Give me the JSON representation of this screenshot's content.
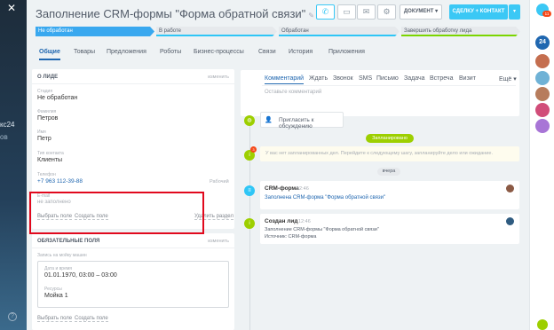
{
  "app": {
    "left_line1": "кс24",
    "left_line2": "ов"
  },
  "header": {
    "title": "Заполнение CRM-формы \"Форма обратной связи\"",
    "document_label": "ДОКУМЕНТ",
    "deal_contact_label": "СДЕЛКУ + КОНТАКТ"
  },
  "stages": [
    {
      "label": "Не обработан",
      "active": true,
      "color": "#39a8ef"
    },
    {
      "label": "В работе",
      "active": false,
      "color": "#2fc6f6"
    },
    {
      "label": "Обработан",
      "active": false,
      "color": "#2fc6f6"
    },
    {
      "label": "Завершить обработку лида",
      "active": false,
      "color": "#7bd500"
    }
  ],
  "tabs": [
    "Общие",
    "Товары",
    "Предложения",
    "Роботы",
    "Бизнес-процессы",
    "Связи",
    "История",
    "Приложения"
  ],
  "about": {
    "header": "О ЛИДЕ",
    "edit": "изменить",
    "status_label": "Стадия",
    "status_value": "Не обработан",
    "lastname_label": "Фамилия",
    "lastname_value": "Петров",
    "name_label": "Имя",
    "name_value": "Петр",
    "type_label": "Тип контакта",
    "type_value": "Клиенты",
    "phone_label": "Телефон",
    "phone_value": "+7 963 112-39-88",
    "phone_type": "Рабочий",
    "email_label": "E-mail",
    "email_value": "не заполнено",
    "choose_field": "Выбрать поле",
    "create_field": "Создать поле",
    "delete_section": "Удалить раздел"
  },
  "required": {
    "header": "ОБЯЗАТЕЛЬНЫЕ ПОЛЯ",
    "edit": "изменить",
    "booking_label": "Запись на мойку машин",
    "datetime_label": "Дата и время",
    "datetime_value": "01.01.1970, 03:00 – 03:00",
    "resources_label": "Ресурсы",
    "resources_value": "Мойка 1",
    "choose_field": "Выбрать поле",
    "create_field": "Создать поле"
  },
  "activity": {
    "tabs": [
      "Комментарий",
      "Ждать",
      "Звонок",
      "SMS",
      "Письмо",
      "Задача",
      "Встреча",
      "Визит"
    ],
    "more": "Ещё",
    "placeholder": "Оставьте комментарий"
  },
  "timeline": {
    "invite": "Пригласить к обсуждению",
    "planned_badge": "Запланировано",
    "planned_text": "У вас нет запланированных дел. Перейдите к следующему шагу, запланируйте дело или ожидание.",
    "yesterday_badge": "вчера",
    "events": [
      {
        "title": "CRM-форма",
        "time": "12:46",
        "text": "Заполнена CRM-форма \"Форма обратной связи\""
      },
      {
        "title": "Создан лид",
        "time": "12:46",
        "text": "Заполнение CRM-формы \"Форма обратной связи\"",
        "source": "Источник: CRM-форма"
      }
    ],
    "lead_badge_count": "3"
  },
  "rightbar": {
    "badge_count": "24",
    "notif_count": "11"
  },
  "colors": {
    "accent": "#2067b0",
    "active_stage": "#39a8ef",
    "deal_button": "#3bc8f5",
    "green": "#9dcf00",
    "highlight": "#e1091d"
  }
}
